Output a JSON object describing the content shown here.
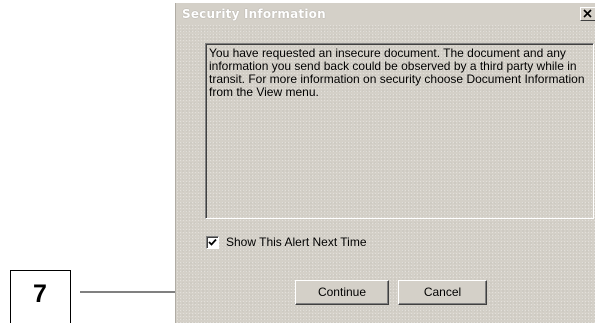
{
  "dialog": {
    "title": "Security Information",
    "close_label": "×",
    "message": "You have requested an insecure document. The document and any information you send back could be observed by a third party while in transit. For more information on security choose Document Information from the View menu.",
    "checkbox": {
      "label": "Show This Alert Next Time",
      "checked": true
    },
    "buttons": {
      "continue": "Continue",
      "cancel": "Cancel"
    }
  },
  "annotation": {
    "step_number": "7"
  },
  "colors": {
    "dialog_background": "#d4d0c8",
    "text": "#000000"
  },
  "icons": {
    "close": "close-icon",
    "check": "check-icon",
    "arrow": "arrow-right-icon"
  }
}
